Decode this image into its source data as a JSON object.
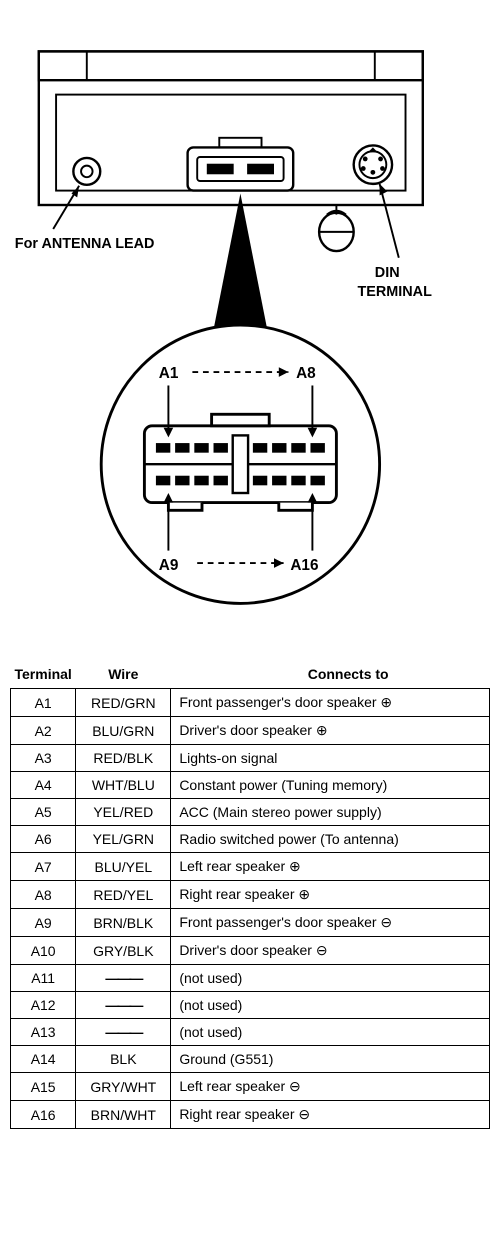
{
  "labels": {
    "antenna": "For ANTENNA LEAD",
    "din": "DIN",
    "terminal": "TERMINAL",
    "a1": "A1",
    "a8": "A8",
    "a9": "A9",
    "a16": "A16"
  },
  "headers": {
    "terminal": "Terminal",
    "wire": "Wire",
    "connects": "Connects to"
  },
  "not_used": "(not used)",
  "dash": "———",
  "rows": [
    {
      "t": "A1",
      "w": "RED/GRN",
      "c": "Front passenger's door speaker ⊕"
    },
    {
      "t": "A2",
      "w": "BLU/GRN",
      "c": "Driver's door speaker ⊕"
    },
    {
      "t": "A3",
      "w": "RED/BLK",
      "c": "Lights-on signal"
    },
    {
      "t": "A4",
      "w": "WHT/BLU",
      "c": "Constant power (Tuning memory)"
    },
    {
      "t": "A5",
      "w": "YEL/RED",
      "c": "ACC (Main stereo power supply)"
    },
    {
      "t": "A6",
      "w": "YEL/GRN",
      "c": "Radio switched power (To antenna)"
    },
    {
      "t": "A7",
      "w": "BLU/YEL",
      "c": "Left rear speaker ⊕"
    },
    {
      "t": "A8",
      "w": "RED/YEL",
      "c": "Right rear speaker ⊕"
    },
    {
      "t": "A9",
      "w": "BRN/BLK",
      "c": "Front passenger's door speaker ⊖"
    },
    {
      "t": "A10",
      "w": "GRY/BLK",
      "c": "Driver's door speaker ⊖"
    },
    {
      "t": "A11",
      "w": null,
      "c": null
    },
    {
      "t": "A12",
      "w": null,
      "c": null
    },
    {
      "t": "A13",
      "w": null,
      "c": null
    },
    {
      "t": "A14",
      "w": "BLK",
      "c": "Ground (G551)"
    },
    {
      "t": "A15",
      "w": "GRY/WHT",
      "c": "Left rear speaker ⊖"
    },
    {
      "t": "A16",
      "w": "BRN/WHT",
      "c": "Right rear speaker ⊖"
    }
  ]
}
